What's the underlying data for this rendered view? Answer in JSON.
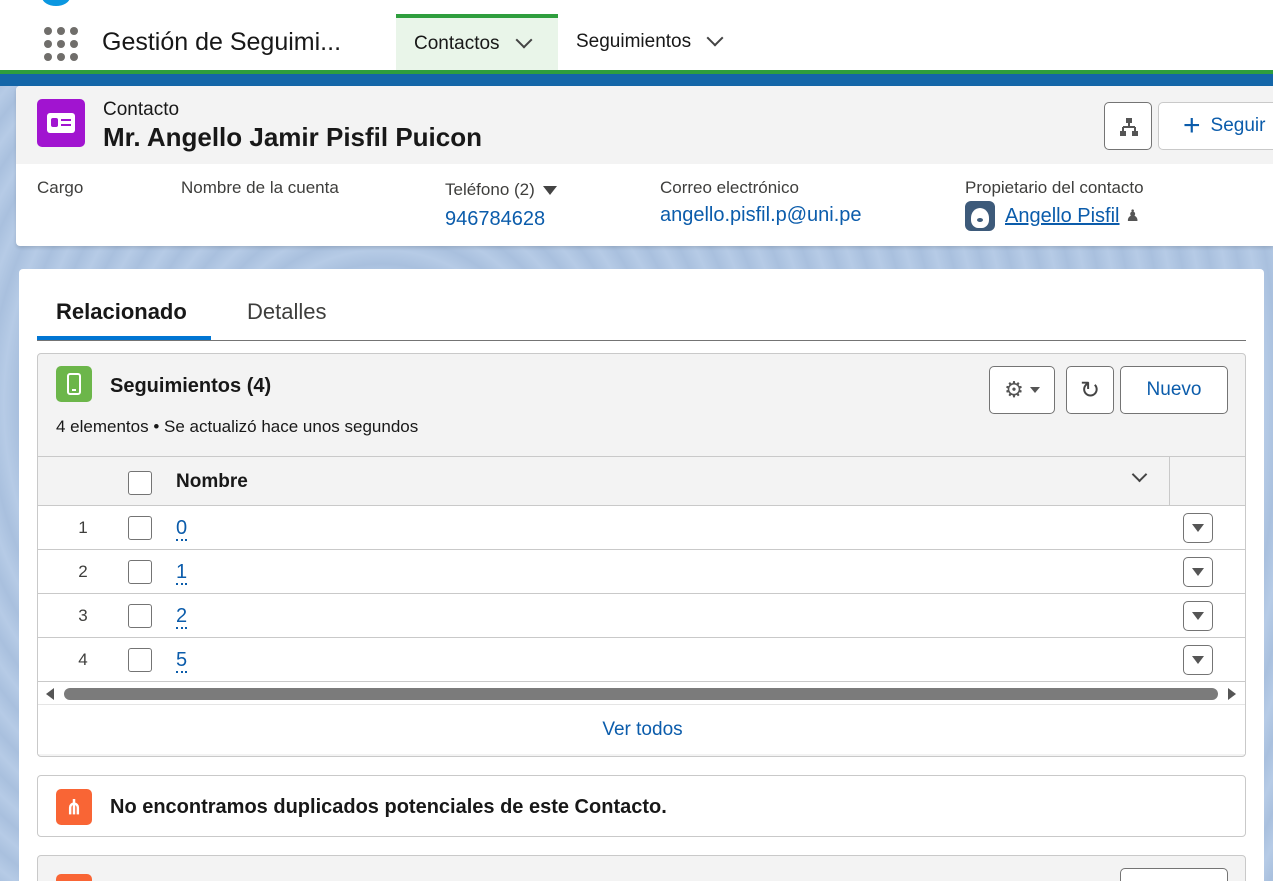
{
  "topnav": {
    "app_name": "Gestión de Seguimi...",
    "tabs": [
      {
        "label": "Contactos",
        "active": true
      },
      {
        "label": "Seguimientos",
        "active": false
      }
    ]
  },
  "record": {
    "type_label": "Contacto",
    "name": "Mr. Angello Jamir Pisfil Puicon",
    "follow_label": "Seguir",
    "fields": {
      "cargo_label": "Cargo",
      "cuenta_label": "Nombre de la cuenta",
      "telefono_label": "Teléfono (2)",
      "telefono_value": "946784628",
      "email_label": "Correo electrónico",
      "email_value": "angello.pisfil.p@uni.pe",
      "owner_label": "Propietario del contacto",
      "owner_value": "Angello Pisfil"
    }
  },
  "tabs": [
    {
      "label": "Relacionado",
      "active": true
    },
    {
      "label": "Detalles",
      "active": false
    }
  ],
  "related_list": {
    "title": "Seguimientos (4)",
    "subtitle": "4 elementos • Se actualizó hace unos segundos",
    "new_label": "Nuevo",
    "column_name": "Nombre",
    "rows": [
      {
        "num": "1",
        "name": "0"
      },
      {
        "num": "2",
        "name": "1"
      },
      {
        "num": "3",
        "name": "2"
      },
      {
        "num": "4",
        "name": "5"
      }
    ],
    "view_all": "Ver todos"
  },
  "duplicates": {
    "message": "No encontramos duplicados potenciales de este Contacto."
  },
  "colors": {
    "brand_green": "#2e9e3d",
    "link_blue": "#0b5cab",
    "contact_icon": "#a114d0",
    "seguimiento_icon": "#6cb64a",
    "duplicate_icon": "#f96535"
  }
}
